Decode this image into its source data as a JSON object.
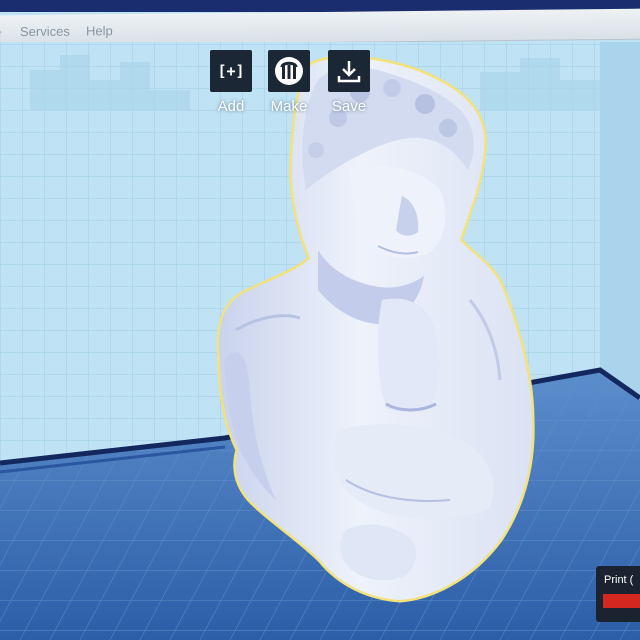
{
  "menu": {
    "items": [
      {
        "label": "Services"
      },
      {
        "label": "Help"
      }
    ]
  },
  "toolbar": {
    "add": {
      "label": "Add",
      "glyph": "[+]",
      "icon": "add-object-icon"
    },
    "make": {
      "label": "Make",
      "glyph": "M",
      "icon": "makerbot-logo-icon"
    },
    "save": {
      "label": "Save",
      "icon": "download-icon"
    }
  },
  "print_panel": {
    "label": "Print (",
    "accent_color": "#d4271f"
  },
  "colors": {
    "build_plate": "#3a6fb0",
    "back_wall": "#bfe2f4",
    "model": "#e4eaf7",
    "model_outline": "#f3e27a"
  }
}
